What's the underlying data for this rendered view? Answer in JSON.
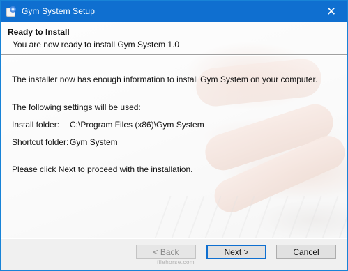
{
  "window": {
    "title": "Gym System Setup",
    "close_glyph": "✕",
    "accent": "#0f6fd0"
  },
  "header": {
    "title": "Ready to Install",
    "subtitle": "You are now ready to install Gym System 1.0"
  },
  "body": {
    "intro": "The installer now has enough information to install Gym System on your computer.",
    "settings_heading": "The following settings will be used:",
    "install_folder_label": "Install folder:",
    "install_folder_value": "C:\\Program Files (x86)\\Gym System",
    "shortcut_folder_label": "Shortcut folder:",
    "shortcut_folder_value": "Gym System",
    "proceed": "Please click Next to proceed with the installation."
  },
  "buttons": {
    "back_prefix": "< ",
    "back_mnemonic": "B",
    "back_rest": "ack",
    "next": "Next >",
    "cancel": "Cancel"
  },
  "watermark": "filehorse.com"
}
